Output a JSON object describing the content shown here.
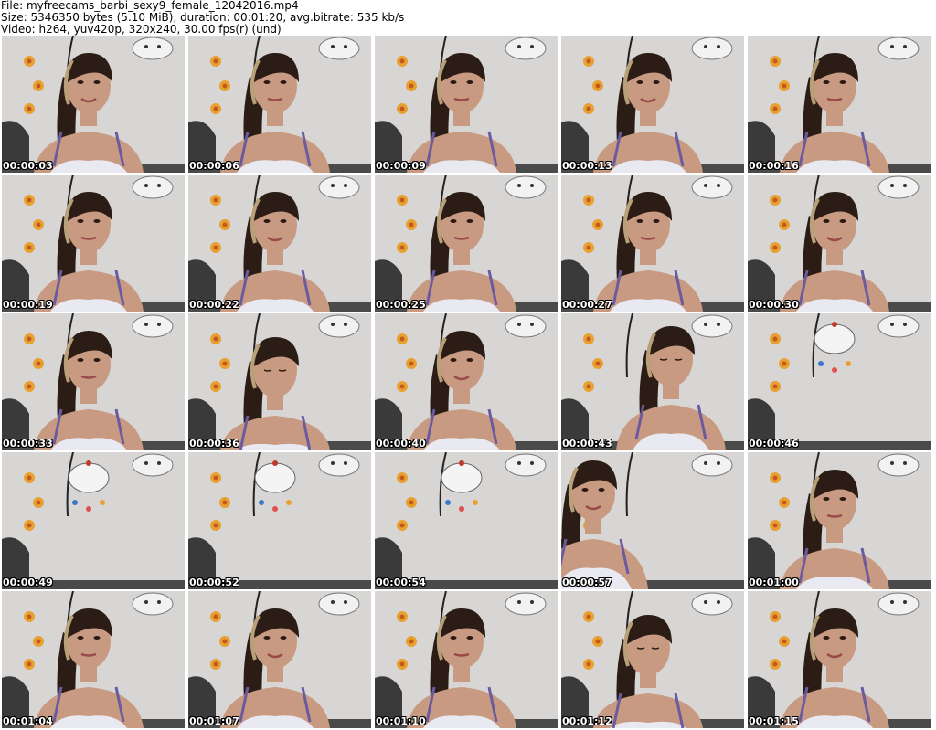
{
  "header": {
    "line1": "File: myfreecams_barbi_sexy9_female_12042016.mp4",
    "line2": "Size: 5346350 bytes (5.10 MiB), duration: 00:01:20, avg.bitrate: 535 kb/s",
    "line3": "Video: h264, yuv420p, 320x240, 30.00 fps(r) (und)"
  },
  "colors": {
    "wall": "#d8d6d4",
    "sofa": "#3a3a3a",
    "skin": "#c89a82",
    "hair": "#2b1d16",
    "top": "#e9e9f2",
    "strap": "#6a5aa0",
    "flower": "#e8a030",
    "drawing": "#222222"
  },
  "thumbnails": [
    {
      "time": "00:00:03",
      "person": "face"
    },
    {
      "time": "00:00:06",
      "person": "face"
    },
    {
      "time": "00:00:09",
      "person": "face"
    },
    {
      "time": "00:00:13",
      "person": "face"
    },
    {
      "time": "00:00:16",
      "person": "face"
    },
    {
      "time": "00:00:19",
      "person": "face"
    },
    {
      "time": "00:00:22",
      "person": "face"
    },
    {
      "time": "00:00:25",
      "person": "face"
    },
    {
      "time": "00:00:27",
      "person": "face"
    },
    {
      "time": "00:00:30",
      "person": "face"
    },
    {
      "time": "00:00:33",
      "person": "face"
    },
    {
      "time": "00:00:36",
      "person": "looking-down"
    },
    {
      "time": "00:00:40",
      "person": "face"
    },
    {
      "time": "00:00:43",
      "person": "side"
    },
    {
      "time": "00:00:46",
      "person": "none"
    },
    {
      "time": "00:00:49",
      "person": "none"
    },
    {
      "time": "00:00:52",
      "person": "none"
    },
    {
      "time": "00:00:54",
      "person": "none"
    },
    {
      "time": "00:00:57",
      "person": "leaning"
    },
    {
      "time": "00:01:00",
      "person": "face"
    },
    {
      "time": "00:01:04",
      "person": "face"
    },
    {
      "time": "00:01:07",
      "person": "face"
    },
    {
      "time": "00:01:10",
      "person": "face"
    },
    {
      "time": "00:01:12",
      "person": "looking-down"
    },
    {
      "time": "00:01:15",
      "person": "face"
    }
  ]
}
